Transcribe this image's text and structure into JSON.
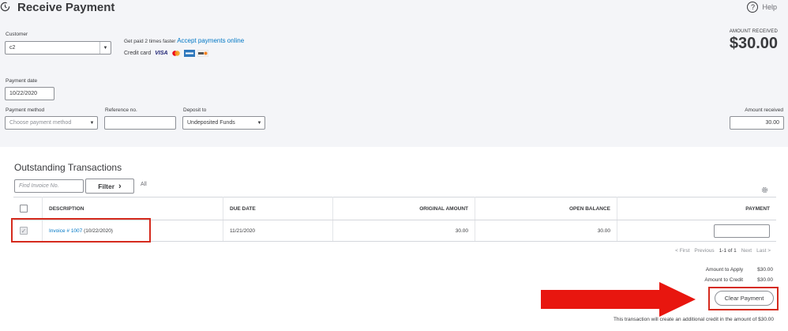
{
  "header": {
    "title": "Receive Payment",
    "help_label": "Help",
    "help_glyph": "?",
    "amount_received_label": "AMOUNT RECEIVED",
    "amount_received_value": "$30.00"
  },
  "customer": {
    "label": "Customer",
    "value": "c2",
    "dropdown_glyph": "▼"
  },
  "promo": {
    "text": "Get paid 2 times faster",
    "link": "Accept payments online",
    "card_label": "Credit card",
    "visa": "VISA"
  },
  "payment_date": {
    "label": "Payment date",
    "value": "10/22/2020"
  },
  "payment_method": {
    "label": "Payment method",
    "placeholder": "Choose payment method",
    "dropdown_glyph": "▼"
  },
  "reference": {
    "label": "Reference no.",
    "value": ""
  },
  "deposit_to": {
    "label": "Deposit to",
    "value": "Undeposited Funds",
    "dropdown_glyph": "▼"
  },
  "amount_received_field": {
    "label": "Amount received",
    "value": "30.00"
  },
  "outstanding": {
    "title": "Outstanding Transactions",
    "search_placeholder": "Find Invoice No.",
    "filter_label": "Filter",
    "filter_glyph": "›",
    "all_label": "All",
    "columns": [
      "DESCRIPTION",
      "DUE DATE",
      "ORIGINAL AMOUNT",
      "OPEN BALANCE",
      "PAYMENT"
    ],
    "rows": [
      {
        "checked": true,
        "check_glyph": "✓",
        "invoice_link": "Invoice # 1007",
        "invoice_date": "(10/22/2020)",
        "due_date": "11/21/2020",
        "original_amount": "30.00",
        "open_balance": "30.00",
        "payment": ""
      }
    ],
    "pager": {
      "first": "< First",
      "previous": "Previous",
      "range": "1-1 of 1",
      "next": "Next",
      "last": "Last >"
    }
  },
  "summary": {
    "amount_to_apply_label": "Amount to Apply",
    "amount_to_apply_value": "$30.00",
    "amount_to_credit_label": "Amount to Credit",
    "amount_to_credit_value": "$30.00",
    "clear_payment_label": "Clear Payment",
    "note": "This transaction will create an additional credit in the amount of $30.00"
  },
  "colors": {
    "accent_link": "#0077c5",
    "highlight_red": "#d52b1e",
    "arrow_red": "#e8160f",
    "header_bg": "#f4f5f8"
  },
  "icons": [
    "history-icon",
    "help-icon",
    "visa-icon",
    "mastercard-icon",
    "amex-icon",
    "discover-icon",
    "gear-icon",
    "filter-chevron-icon",
    "red-arrow-icon"
  ]
}
